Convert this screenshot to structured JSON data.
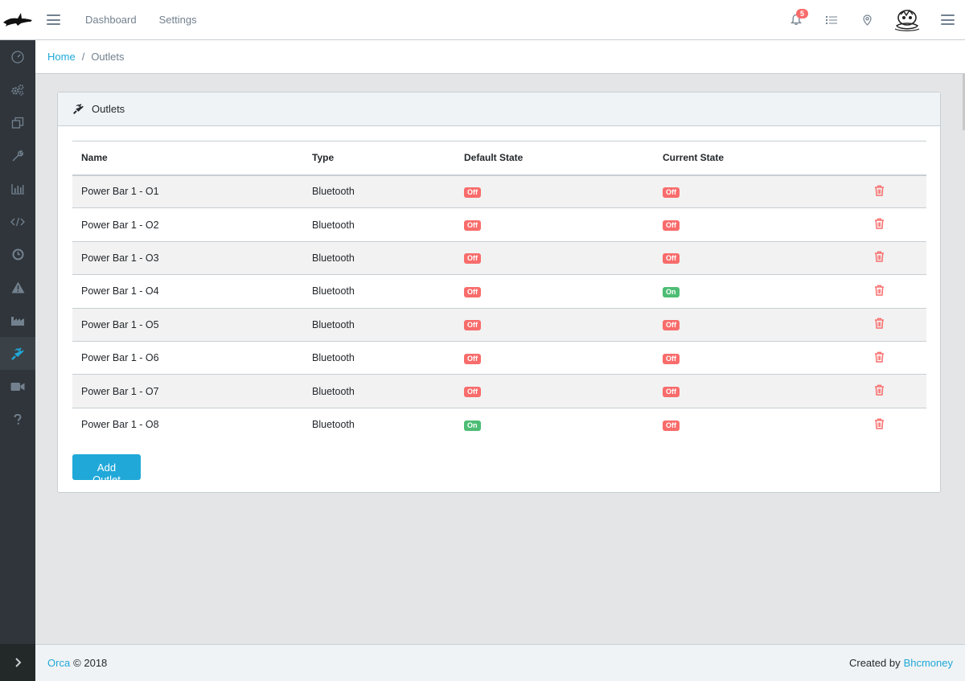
{
  "header": {
    "nav": [
      {
        "label": "Dashboard"
      },
      {
        "label": "Settings"
      }
    ],
    "notification_count": "5"
  },
  "sidebar": {
    "items": [
      {
        "icon": "speedometer-icon"
      },
      {
        "icon": "gears-icon"
      },
      {
        "icon": "layers-icon"
      },
      {
        "icon": "tools-icon"
      },
      {
        "icon": "bar-chart-icon"
      },
      {
        "icon": "code-icon"
      },
      {
        "icon": "clock-icon"
      },
      {
        "icon": "warning-icon"
      },
      {
        "icon": "area-chart-icon"
      },
      {
        "icon": "plug-icon",
        "active": true
      },
      {
        "icon": "video-camera-icon"
      },
      {
        "icon": "question-icon"
      }
    ]
  },
  "breadcrumb": {
    "home": "Home",
    "separator": "/",
    "current": "Outlets"
  },
  "card": {
    "title": "Outlets",
    "columns": [
      "Name",
      "Type",
      "Default State",
      "Current State"
    ],
    "rows": [
      {
        "name": "Power Bar 1 - O1",
        "type": "Bluetooth",
        "default_state": "Off",
        "current_state": "Off"
      },
      {
        "name": "Power Bar 1 - O2",
        "type": "Bluetooth",
        "default_state": "Off",
        "current_state": "Off"
      },
      {
        "name": "Power Bar 1 - O3",
        "type": "Bluetooth",
        "default_state": "Off",
        "current_state": "Off"
      },
      {
        "name": "Power Bar 1 - O4",
        "type": "Bluetooth",
        "default_state": "Off",
        "current_state": "On"
      },
      {
        "name": "Power Bar 1 - O5",
        "type": "Bluetooth",
        "default_state": "Off",
        "current_state": "Off"
      },
      {
        "name": "Power Bar 1 - O6",
        "type": "Bluetooth",
        "default_state": "Off",
        "current_state": "Off"
      },
      {
        "name": "Power Bar 1 - O7",
        "type": "Bluetooth",
        "default_state": "Off",
        "current_state": "Off"
      },
      {
        "name": "Power Bar 1 - O8",
        "type": "Bluetooth",
        "default_state": "On",
        "current_state": "Off"
      }
    ],
    "add_button": "Add Outlet"
  },
  "footer": {
    "brand": "Orca",
    "copyright": "© 2018",
    "created_by": "Created by",
    "author": "Bhcmoney"
  },
  "colors": {
    "accent": "#20a8d8",
    "off": "#f86c6b",
    "on": "#4dbd74",
    "sidebar": "#2f353a"
  }
}
